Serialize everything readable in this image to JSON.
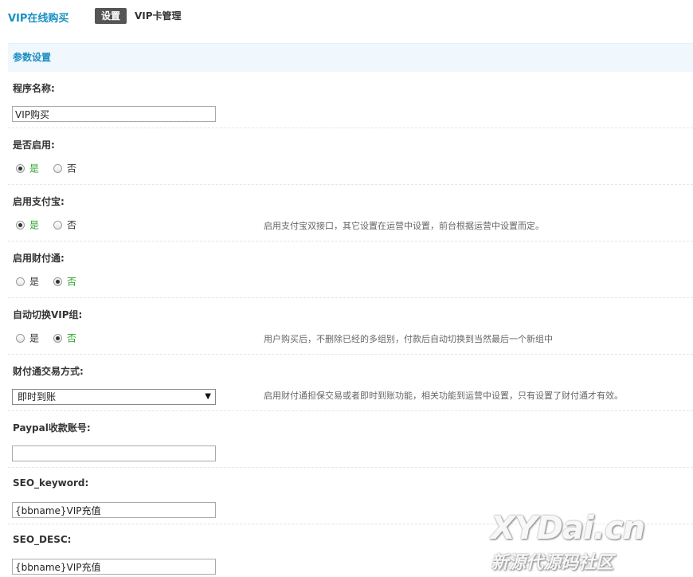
{
  "header": {
    "app_title": "VIP在线购买",
    "tabs": [
      {
        "label": "设置",
        "active": true
      },
      {
        "label": "VIP卡管理",
        "active": false
      }
    ]
  },
  "section_title": "参数设置",
  "fields": {
    "program_name": {
      "label": "程序名称:",
      "value": "VIP购买"
    },
    "enabled": {
      "label": "是否启用:",
      "options": [
        "是",
        "否"
      ],
      "selected": "是"
    },
    "alipay": {
      "label": "启用支付宝:",
      "options": [
        "是",
        "否"
      ],
      "selected": "是",
      "hint": "启用支付宝双接口，其它设置在运营中设置，前台根据运营中设置而定。"
    },
    "tenpay": {
      "label": "启用财付通:",
      "options": [
        "是",
        "否"
      ],
      "selected": "否"
    },
    "auto_switch": {
      "label": "自动切换VIP组:",
      "options": [
        "是",
        "否"
      ],
      "selected": "否",
      "hint": "用户购买后，不删除已经的多组别，付款后自动切换到当然最后一个新组中"
    },
    "tenpay_mode": {
      "label": "财付通交易方式:",
      "value": "即时到账",
      "hint": "启用财付通担保交易或者即时到账功能，相关功能到运营中设置，只有设置了财付通才有效。"
    },
    "paypal": {
      "label": "Paypal收款账号:",
      "value": ""
    },
    "seo_keyword": {
      "label": "SEO_keyword:",
      "value": "{bbname}VIP充值"
    },
    "seo_desc": {
      "label": "SEO_DESC:",
      "value": "{bbname}VIP充值"
    }
  },
  "watermark": {
    "line1": "XYDai.cn",
    "line2": "新源代源码社区"
  },
  "colors": {
    "accent": "#1a8fc4",
    "selected_option": "#2aa52a",
    "section_bg": "#f0f7fd",
    "tab_active_bg": "#555555"
  },
  "icons": {
    "select_arrow": "triangle-down-icon"
  }
}
